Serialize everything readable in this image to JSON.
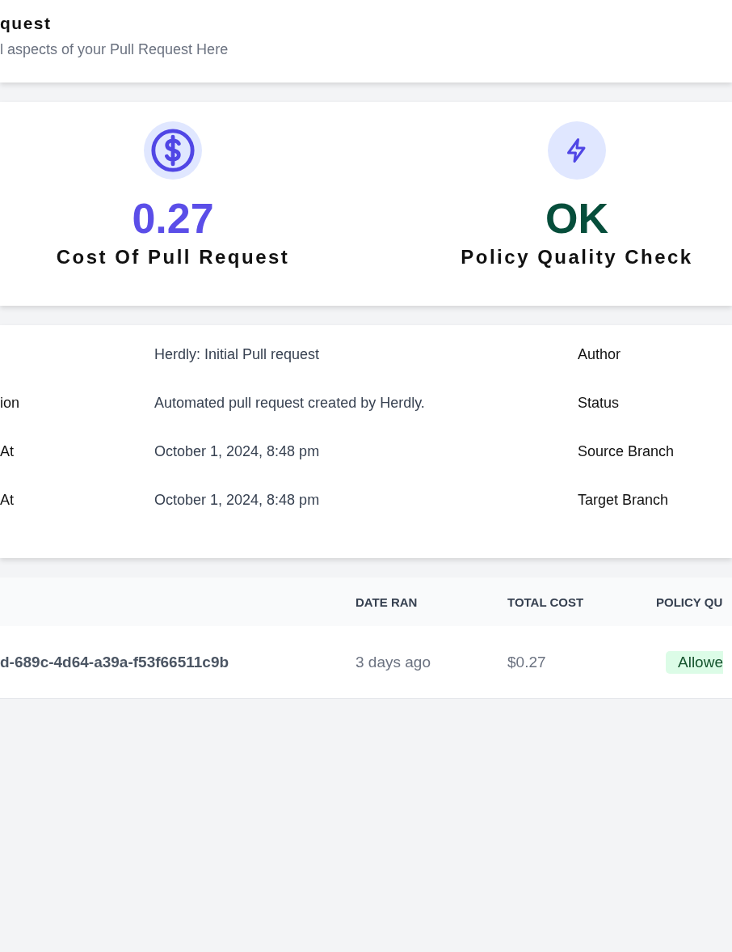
{
  "header": {
    "title": "quest",
    "subtitle": "l aspects of your Pull Request Here"
  },
  "stats": [
    {
      "kind": "cost",
      "value": "0.27",
      "label": "Cost Of Pull Request"
    },
    {
      "kind": "policy",
      "value": "OK",
      "label": "Policy Quality Check"
    }
  ],
  "details": [
    {
      "value": "Herdly: Initial Pull request",
      "right_label": "Author"
    },
    {
      "label": "ion",
      "value": "Automated pull request created by Herdly.",
      "right_label": "Status"
    },
    {
      "label": "At",
      "value": "October 1, 2024, 8:48 pm",
      "right_label": "Source Branch"
    },
    {
      "label": "At",
      "value": "October 1, 2024, 8:48 pm",
      "right_label": "Target Branch"
    }
  ],
  "table": {
    "columns": [
      "DATE RAN",
      "TOTAL COST",
      "POLICY QU"
    ],
    "rows": [
      {
        "id": "d-689c-4d64-a39a-f53f66511c9b",
        "date_ran": "3 days ago",
        "total_cost": "$0.27",
        "policy": "Allowe"
      }
    ]
  }
}
